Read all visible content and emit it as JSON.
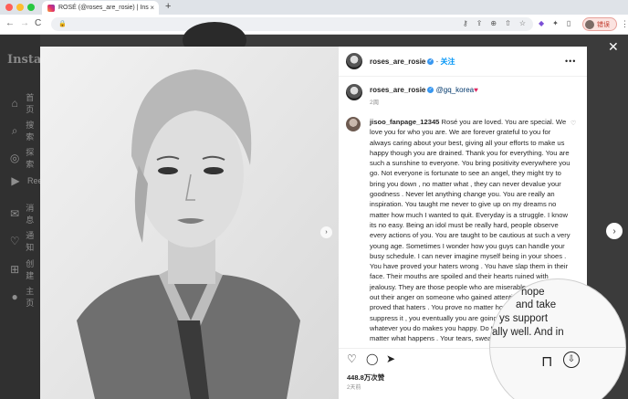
{
  "browser": {
    "tab_title": "ROSÉ (@roses_are_rosie) | Ins",
    "tab_close": "×",
    "new_tab": "+",
    "back": "←",
    "forward": "→",
    "reload": "C",
    "lock": "🔒",
    "omni_icons": [
      "⚷",
      "⇪",
      "⊕",
      "⇧",
      "☆"
    ],
    "ext_icons": [
      "◆",
      "✦",
      "▯"
    ],
    "profile_label": "错误",
    "menu": "⋮"
  },
  "instagram_sidebar": {
    "logo": "Instag",
    "items": [
      {
        "icon": "⌂",
        "label": "首页"
      },
      {
        "icon": "⌕",
        "label": "搜索"
      },
      {
        "icon": "◎",
        "label": "探索"
      },
      {
        "icon": "▶",
        "label": "Reels"
      },
      {
        "icon": "✉",
        "label": "消息"
      },
      {
        "icon": "♡",
        "label": "通知"
      },
      {
        "icon": "⊞",
        "label": "创建"
      },
      {
        "icon": "●",
        "label": "主页"
      }
    ]
  },
  "post": {
    "author": "roses_are_rosie",
    "follow_label": "关注",
    "more": "•••",
    "caption_mention": "@gq_korea",
    "caption_heart": "♥",
    "caption_time": "2周",
    "comment": {
      "author": "jisoo_fanpage_12345",
      "text": "Rosé you are loved. You are special. We love you for who you are. We are forever grateful to you for always caring about your best, giving all your efforts to make us happy though you are drained. Thank you for everything. You are such a sunshine to everyone. You bring positivity everywhere you go. Not everyone is fortunate to see an angel, they might try to bring you down , no matter what , they can never devalue your goodness . Never let anything change you. You are really an inspiration. You taught me never to give up on my dreams no matter how much I wanted to quit. Everyday is a struggle. I know its no easy. Being an idol must be really hard, people observe every actions of you. You are taught to be cautious at such a very young age. Sometimes I wonder how you guys can handle your busy schedule. I can never imagine myself being in your shoes . You have proved your haters wrong . You have slap them in their face. Their mouths are spoiled and their hearts ruined with jealousy. They are those people who are miserable and lashes out their anger on someone who gained attention . You have proved that haters . You prove no matter how much they suppress it , you eventually you are going to shine more and whatever you do makes you happy. Do take proper rest. No matter what happens . Your tears, sweat and hard work"
    },
    "magnified_lines": [
      "hope",
      "and take",
      "ys support",
      "ally well. And in"
    ],
    "likes": "448.8万次赞",
    "time": "2天前",
    "actions": {
      "like": "♡",
      "comment": "◯",
      "share": "➤",
      "save": "⊓",
      "download": "⇩"
    },
    "close": "✕",
    "next": "›",
    "photo_next": "›"
  }
}
